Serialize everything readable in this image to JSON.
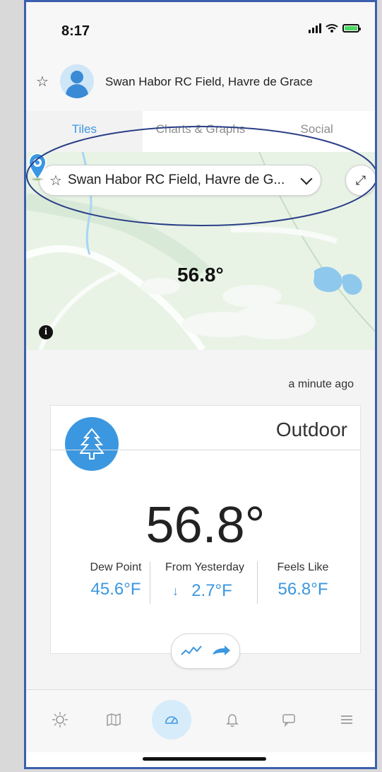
{
  "status_bar": {
    "time": "8:17",
    "signal_icon": "signal-icon",
    "wifi_icon": "wifi-icon",
    "battery_icon": "battery-charging-icon"
  },
  "header": {
    "location_name": "Swan Habor RC Field, Havre de Grace",
    "favorite_icon": "star-outline-icon",
    "avatar_icon": "user-avatar-icon"
  },
  "tabs": [
    {
      "label": "Tiles",
      "active": true
    },
    {
      "label": "Charts & Graphs",
      "active": false
    },
    {
      "label": "Social",
      "active": false
    }
  ],
  "map": {
    "location_selector_text": "Swan Habor RC Field, Havre de G...",
    "temperature_label": "56.8°",
    "info_icon": "info-icon",
    "expand_icon": "expand-icon",
    "marker_icon": "location-marker-icon"
  },
  "summary": {
    "updated_text": "a minute ago",
    "card_title": "Outdoor",
    "card_icon": "tree-icon",
    "temperature": "56.8°",
    "stats": [
      {
        "label": "Dew Point",
        "value": "45.6°F"
      },
      {
        "label": "From Yesterday",
        "value": "2.7°F",
        "trend": "↓"
      },
      {
        "label": "Feels Like",
        "value": "56.8°F"
      }
    ],
    "chart_button_icon": "trend-chart-icon",
    "share_icon": "share-arrow-icon"
  },
  "bottom_nav": [
    {
      "icon": "weather-icon",
      "active": false
    },
    {
      "icon": "map-icon",
      "active": false
    },
    {
      "icon": "dashboard-icon",
      "active": true
    },
    {
      "icon": "notifications-icon",
      "active": false
    },
    {
      "icon": "messages-icon",
      "active": false
    },
    {
      "icon": "menu-icon",
      "active": false
    }
  ],
  "colors": {
    "accent": "#3b97e0",
    "annotation": "#2a3f86",
    "map_green": "#e8f3e6"
  }
}
